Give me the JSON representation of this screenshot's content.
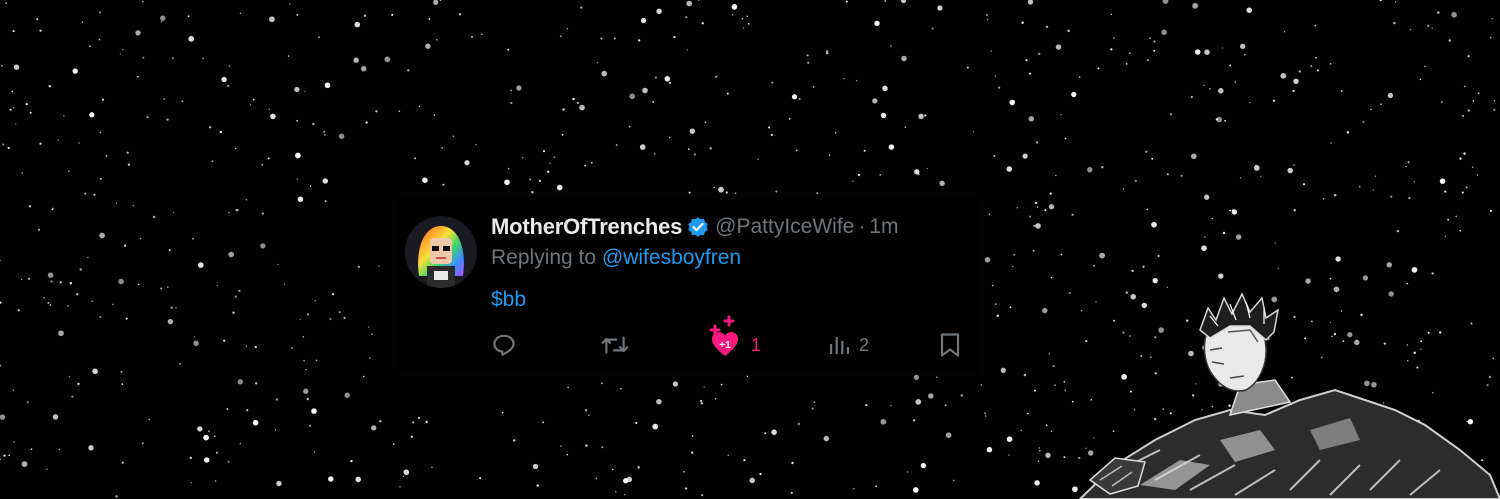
{
  "tweet": {
    "display_name": "MotherOfTrenches",
    "handle": "@PattyIceWife",
    "separator": "·",
    "time": "1m",
    "reply_prefix": "Replying to",
    "reply_mention": "@wifesboyfren",
    "text": "$bb",
    "like_count": "1",
    "like_badge": "+1",
    "view_count": "2"
  },
  "icons": {
    "verified": "verified-badge-icon",
    "reply": "reply-icon",
    "retweet": "retweet-icon",
    "like": "liked-heart-icon",
    "views": "views-chart-icon",
    "bookmark": "bookmark-icon"
  },
  "colors": {
    "background": "#000000",
    "name": "#e7e9ea",
    "muted": "#71767b",
    "link": "#1d9bf0",
    "like": "#f91880"
  }
}
